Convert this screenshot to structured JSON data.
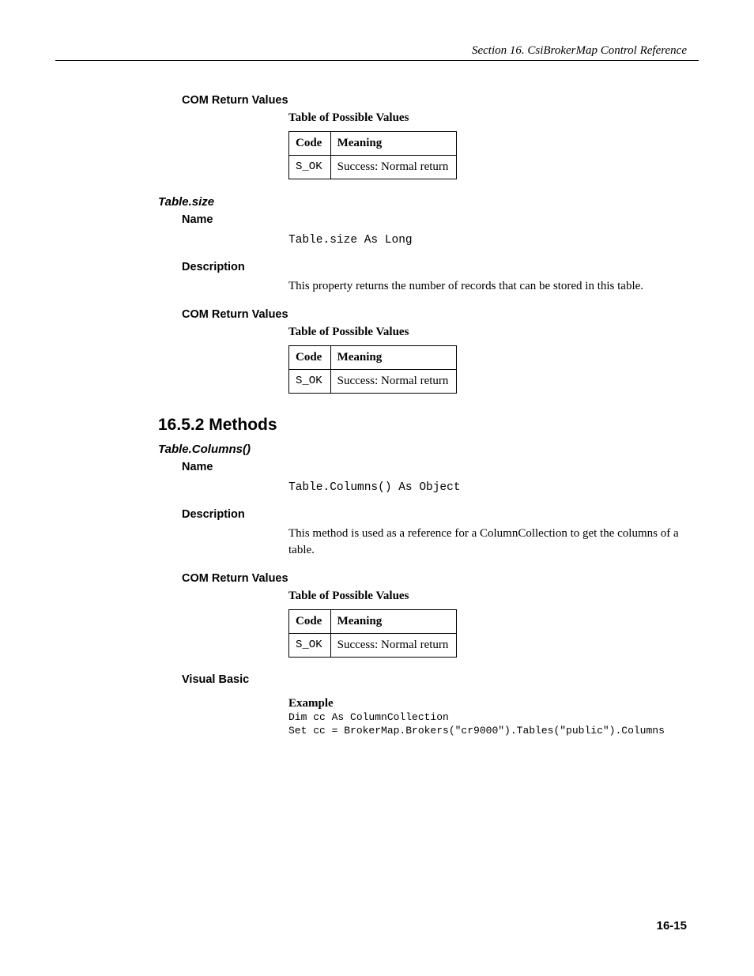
{
  "header": {
    "running": "Section 16.  CsiBrokerMap Control Reference"
  },
  "s1": {
    "h_com": "COM Return Values",
    "caption": "Table of Possible Values",
    "th_code": "Code",
    "th_meaning": "Meaning",
    "row_code": "S_OK",
    "row_meaning": "Success: Normal return"
  },
  "s2": {
    "title": "Table.size",
    "h_name": "Name",
    "signature": "Table.size As Long",
    "h_desc": "Description",
    "desc": "This property returns the number of records that can be stored in this table.",
    "h_com": "COM Return Values",
    "caption": "Table of Possible Values",
    "th_code": "Code",
    "th_meaning": "Meaning",
    "row_code": "S_OK",
    "row_meaning": "Success: Normal return"
  },
  "s3": {
    "sect": "16.5.2  Methods",
    "title": "Table.Columns()",
    "h_name": "Name",
    "signature": "Table.Columns() As Object",
    "h_desc": "Description",
    "desc": "This method is used as a reference for a ColumnCollection to get the columns of a table.",
    "h_com": "COM Return Values",
    "caption": "Table of Possible Values",
    "th_code": "Code",
    "th_meaning": "Meaning",
    "row_code": "S_OK",
    "row_meaning": "Success: Normal return",
    "h_vb": "Visual Basic",
    "example_label": "Example",
    "example1": "Dim cc As ColumnCollection",
    "example2": "Set cc = BrokerMap.Brokers(\"cr9000\").Tables(\"public\").Columns"
  },
  "footer": {
    "pagenum": "16-15"
  }
}
